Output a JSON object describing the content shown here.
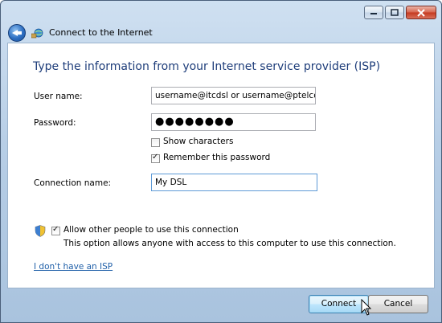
{
  "window": {
    "title": "Connect to the Internet"
  },
  "form": {
    "heading": "Type the information from your Internet service provider (ISP)",
    "username_label": "User name:",
    "username_value": "username@itcdsl or username@ptelco-dsl",
    "password_label": "Password:",
    "password_masked": "●●●●●●●●",
    "show_characters_label": "Show characters",
    "show_characters_checked": false,
    "remember_password_label": "Remember this password",
    "remember_password_checked": true,
    "connection_name_label": "Connection name:",
    "connection_name_value": "My DSL",
    "allow_others_label": "Allow other people to use this connection",
    "allow_others_checked": true,
    "allow_others_description": "This option allows anyone with access to this computer to use this connection.",
    "no_isp_link": "I don't have an ISP"
  },
  "footer": {
    "connect_label": "Connect",
    "cancel_label": "Cancel"
  },
  "colors": {
    "heading": "#1e3d7a",
    "link": "#1f5fa8",
    "frame": "#b7cee6"
  }
}
